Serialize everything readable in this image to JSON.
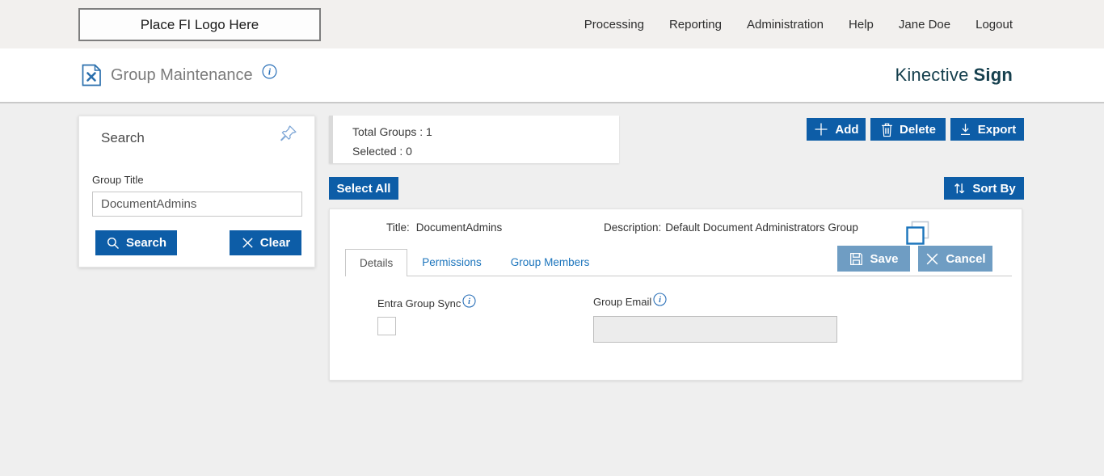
{
  "topbar": {
    "logo_placeholder": "Place FI Logo Here",
    "nav": [
      {
        "label": "Processing"
      },
      {
        "label": "Reporting"
      },
      {
        "label": "Administration"
      },
      {
        "label": "Help"
      },
      {
        "label": "Jane Doe"
      },
      {
        "label": "Logout"
      }
    ]
  },
  "header": {
    "page_title": "Group Maintenance",
    "brand_name": "Kinective",
    "brand_product": "Sign"
  },
  "search_panel": {
    "title": "Search",
    "group_title_label": "Group Title",
    "group_title_value": "DocumentAdmins",
    "search_button": "Search",
    "clear_button": "Clear"
  },
  "summary": {
    "total_groups_label": "Total Groups :",
    "total_groups_value": "1",
    "selected_label": "Selected :",
    "selected_value": "0"
  },
  "toolbar": {
    "add_label": "Add",
    "delete_label": "Delete",
    "export_label": "Export",
    "select_all_label": "Select All",
    "sort_by_label": "Sort By"
  },
  "group": {
    "title_label": "Title:",
    "title_value": "DocumentAdmins",
    "description_label": "Description:",
    "description_value": "Default Document Administrators Group",
    "tabs": [
      {
        "label": "Details"
      },
      {
        "label": "Permissions"
      },
      {
        "label": "Group Members"
      }
    ],
    "save_label": "Save",
    "cancel_label": "Cancel",
    "details": {
      "entra_group_sync_label": "Entra Group Sync",
      "entra_group_sync_checked": false,
      "group_email_label": "Group Email",
      "group_email_value": ""
    }
  },
  "icons": {
    "page_icon": "document-tools-icon",
    "info": "info-icon",
    "pin": "pushpin-icon",
    "search": "magnifier-icon",
    "clear": "x-icon",
    "add": "plus-icon",
    "delete": "trash-icon",
    "export": "download-icon",
    "sort": "up-down-arrows-icon",
    "copy": "copy-icon",
    "save": "floppy-disk-icon"
  },
  "colors": {
    "primary_blue": "#0d5da7",
    "muted_blue": "#6f9dc3",
    "link_blue": "#1b74bc",
    "brand_teal": "#16404e",
    "topbar_bg": "#f2f0ee",
    "page_bg": "#efefef",
    "title_gray": "#7b7b7b"
  }
}
